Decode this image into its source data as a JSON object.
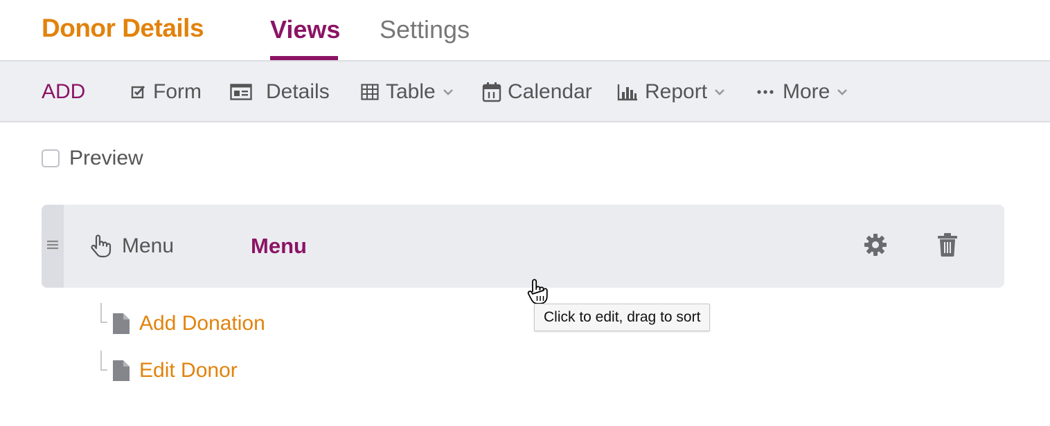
{
  "header": {
    "app_title": "Donor Details",
    "tabs": [
      {
        "label": "Views",
        "active": true
      },
      {
        "label": "Settings",
        "active": false
      }
    ]
  },
  "toolbar": {
    "add_label": "ADD",
    "items": [
      {
        "label": "Form",
        "icon": "checkbox-edit-icon",
        "dropdown": false
      },
      {
        "label": "Details",
        "icon": "details-card-icon",
        "dropdown": false
      },
      {
        "label": "Table",
        "icon": "table-grid-icon",
        "dropdown": true
      },
      {
        "label": "Calendar",
        "icon": "calendar-icon",
        "dropdown": false
      },
      {
        "label": "Report",
        "icon": "bar-chart-icon",
        "dropdown": true
      },
      {
        "label": "More",
        "icon": "ellipsis-icon",
        "dropdown": true
      }
    ]
  },
  "preview": {
    "label": "Preview",
    "checked": false
  },
  "menu_block": {
    "type_label": "Menu",
    "type_icon": "pointer-hand-icon",
    "name": "Menu",
    "actions": [
      "gear-icon",
      "trash-icon"
    ],
    "children": [
      {
        "label": "Add Donation",
        "icon": "page-icon"
      },
      {
        "label": "Edit Donor",
        "icon": "page-icon"
      }
    ]
  },
  "tooltip": {
    "text": "Click to edit, drag to sort"
  },
  "colors": {
    "brand_orange": "#e2820c",
    "accent_purple": "#8b1465",
    "toolbar_bg": "#eeeff3",
    "block_bg": "#ebecf0"
  }
}
